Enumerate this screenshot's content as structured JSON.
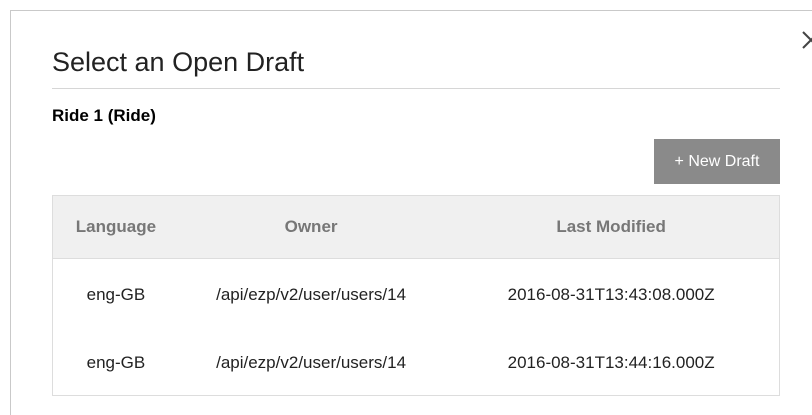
{
  "dialog": {
    "title": "Select an Open Draft",
    "subtitle": "Ride 1 (Ride)",
    "new_draft_label": "+ New Draft"
  },
  "table": {
    "headers": {
      "language": "Language",
      "owner": "Owner",
      "last_modified": "Last Modified"
    },
    "rows": [
      {
        "language": "eng-GB",
        "owner": "/api/ezp/v2/user/users/14",
        "last_modified": "2016-08-31T13:43:08.000Z"
      },
      {
        "language": "eng-GB",
        "owner": "/api/ezp/v2/user/users/14",
        "last_modified": "2016-08-31T13:44:16.000Z"
      }
    ]
  },
  "icons": {
    "close": "close-icon"
  },
  "colors": {
    "button_bg": "#8a8a8a",
    "header_bg": "#f0f0f0",
    "header_text": "#777777",
    "border": "#dddddd"
  }
}
